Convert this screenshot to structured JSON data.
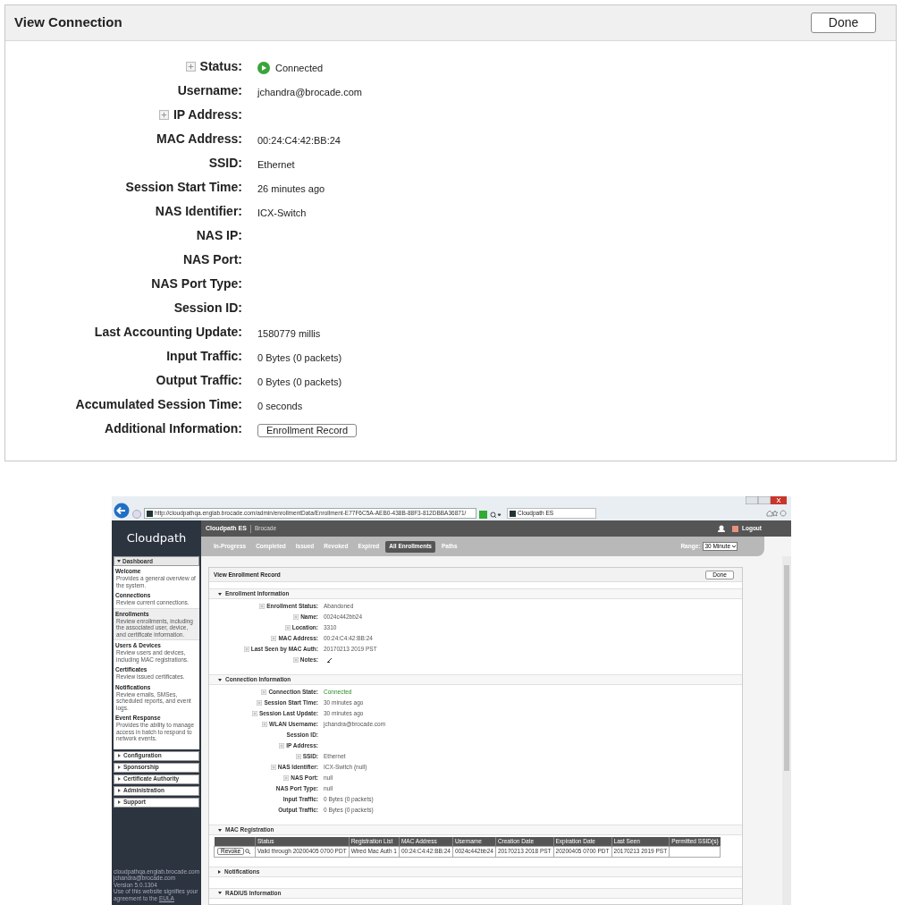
{
  "connection": {
    "title": "View Connection",
    "done_button": "Done",
    "fields": [
      {
        "label": "Status:",
        "value": "Connected",
        "expandable": true,
        "kind": "status"
      },
      {
        "label": "Username:",
        "value": "jchandra@brocade.com",
        "expandable": false,
        "kind": "text"
      },
      {
        "label": "IP Address:",
        "expandable": true,
        "kind": "text"
      },
      {
        "label": "MAC Address:",
        "value": "00:24:C4:42:BB:24",
        "expandable": false,
        "kind": "text"
      },
      {
        "label": "SSID:",
        "value": "Ethernet",
        "expandable": false,
        "kind": "text"
      },
      {
        "label": "Session Start Time:",
        "value": "26 minutes ago",
        "expandable": false,
        "kind": "text"
      },
      {
        "label": "NAS Identifier:",
        "value": "ICX-Switch",
        "expandable": false,
        "kind": "text"
      },
      {
        "label": "NAS IP:",
        "expandable": false,
        "kind": "text"
      },
      {
        "label": "NAS Port:",
        "expandable": false,
        "kind": "text"
      },
      {
        "label": "NAS Port Type:",
        "expandable": false,
        "kind": "text"
      },
      {
        "label": "Session ID:",
        "expandable": false,
        "kind": "text"
      },
      {
        "label": "Last Accounting Update:",
        "value": "1580779 millis",
        "expandable": false,
        "kind": "text"
      },
      {
        "label": "Input Traffic:",
        "value": "0 Bytes (0 packets)",
        "expandable": false,
        "kind": "text"
      },
      {
        "label": "Output Traffic:",
        "value": "0 Bytes (0 packets)",
        "expandable": false,
        "kind": "text"
      },
      {
        "label": "Accumulated Session Time:",
        "value": "0 seconds",
        "expandable": false,
        "kind": "text"
      },
      {
        "label": "Additional Information:",
        "value": "Enrollment Record",
        "expandable": false,
        "kind": "button"
      }
    ]
  },
  "browser": {
    "url": "http://cloudpathqa.englab.brocade.com/admin/enrollmentData/Enrollment-E77F6C5A-AEB0-438B-88F3-812DBBA36871/",
    "tab_title": "Cloudpath ES",
    "app": {
      "logo": "Cloudpath",
      "product": "Cloudpath ES",
      "org": "Brocade",
      "logout": "Logout",
      "nav_tabs": [
        {
          "label": "In-Progress",
          "selected": false
        },
        {
          "label": "Completed",
          "selected": false
        },
        {
          "label": "Issued",
          "selected": false
        },
        {
          "label": "Revoked",
          "selected": false
        },
        {
          "label": "Expired",
          "selected": false
        },
        {
          "label": "All Enrollments",
          "selected": true
        },
        {
          "label": "Paths",
          "selected": false
        }
      ],
      "range_label": "Range:",
      "range_value": "30 Minute",
      "sidebar": {
        "dashboard": "Dashboard",
        "items": [
          {
            "title": "Welcome",
            "description": "Provides a general overview of the system.",
            "selected": false
          },
          {
            "title": "Connections",
            "description": "Review current connections.",
            "selected": false
          },
          {
            "title": "Enrollments",
            "description": "Review enrollments, including the associated user, device, and certificate information.",
            "selected": true
          },
          {
            "title": "Users & Devices",
            "description": "Review users and devices, including MAC registrations.",
            "selected": false
          },
          {
            "title": "Certificates",
            "description": "Review issued certificates.",
            "selected": false
          },
          {
            "title": "Notifications",
            "description": "Review emails, SMSes, scheduled reports, and event logs.",
            "selected": false
          },
          {
            "title": "Event Response",
            "description": "Provides the ability to manage access in batch to respond to network events.",
            "selected": false
          }
        ],
        "sections": [
          "Configuration",
          "Sponsorship",
          "Certificate Authority",
          "Administration",
          "Support"
        ],
        "footer": [
          "cloudpathqa.englab.brocade.com",
          "jchandra@brocade.com",
          "Version 5.0.1304"
        ],
        "agreement": "Use of this website signifies your agreement to the",
        "eula": "EULA"
      },
      "record": {
        "title": "View Enrollment Record",
        "done_button": "Done",
        "sections": [
          {
            "title": "Enrollment Information",
            "expanded": true,
            "fields": [
              {
                "label": "Enrollment Status:",
                "value": "Abandoned",
                "expandable": true,
                "kind": "text"
              },
              {
                "label": "Name:",
                "value": "0024c442bb24",
                "expandable": true,
                "kind": "text"
              },
              {
                "label": "Location:",
                "value": "3310",
                "expandable": true,
                "kind": "text"
              },
              {
                "label": "MAC Address:",
                "value": "00:24:C4:42:BB:24",
                "expandable": true,
                "kind": "text"
              },
              {
                "label": "Last Seen by MAC Auth:",
                "value": "20170213 2019 PST",
                "expandable": true,
                "kind": "text"
              },
              {
                "label": "Notes:",
                "expandable": true,
                "kind": "edit"
              }
            ]
          },
          {
            "title": "Connection Information",
            "expanded": true,
            "fields": [
              {
                "label": "Connection State:",
                "value": "Connected",
                "expandable": true,
                "kind": "good"
              },
              {
                "label": "Session Start Time:",
                "value": "30 minutes ago",
                "expandable": true,
                "kind": "text"
              },
              {
                "label": "Session Last Update:",
                "value": "30 minutes ago",
                "expandable": true,
                "kind": "text"
              },
              {
                "label": "WLAN Username:",
                "value": "jchandra@brocade.com",
                "expandable": true,
                "kind": "text"
              },
              {
                "label": "Session ID:",
                "expandable": false,
                "kind": "text"
              },
              {
                "label": "IP Address:",
                "expandable": true,
                "kind": "text"
              },
              {
                "label": "SSID:",
                "value": "Ethernet",
                "expandable": true,
                "kind": "text"
              },
              {
                "label": "NAS Identifier:",
                "value": "ICX-Switch (null)",
                "expandable": true,
                "kind": "text"
              },
              {
                "label": "NAS Port:",
                "value": "null",
                "expandable": true,
                "kind": "text"
              },
              {
                "label": "NAS Port Type:",
                "value": "null",
                "expandable": false,
                "kind": "text"
              },
              {
                "label": "Input Traffic:",
                "value": "0 Bytes (0 packets)",
                "expandable": false,
                "kind": "text"
              },
              {
                "label": "Output Traffic:",
                "value": "0 Bytes (0 packets)",
                "expandable": false,
                "kind": "text"
              }
            ]
          },
          {
            "title": "MAC Registration",
            "expanded": true,
            "table": {
              "columns": [
                "Status",
                "Registration List",
                "MAC Address",
                "Username",
                "Creation Date",
                "Expiration Date",
                "Last Seen",
                "Permitted SSID(s)"
              ],
              "rows": [
                {
                  "action": "Revoke",
                  "cells": [
                    "Valid through 20200405 0700 PDT",
                    "Wired Mac Auth 1",
                    "00:24:C4:42:BB:24",
                    "0024c442bb24",
                    "20170213 2018 PST",
                    "20200405 0700 PDT",
                    "20170213 2019 PST"
                  ]
                }
              ]
            }
          },
          {
            "title": "Notifications",
            "expanded": false
          },
          {
            "title": "RADIUS Information",
            "expanded": true
          }
        ]
      }
    }
  }
}
